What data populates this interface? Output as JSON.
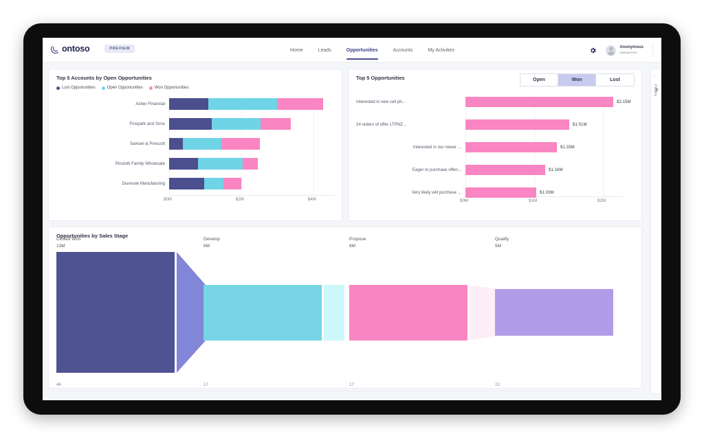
{
  "app": {
    "brand_name": "ontoso",
    "preview_badge": "PREVIEW"
  },
  "nav": {
    "items": [
      {
        "label": "Home",
        "active": false
      },
      {
        "label": "Leads",
        "active": false
      },
      {
        "label": "Opportunities",
        "active": true
      },
      {
        "label": "Accounts",
        "active": false
      },
      {
        "label": "My Activities",
        "active": false
      }
    ]
  },
  "topright": {
    "settings_icon": "gear-icon",
    "user_name": "Anonymous",
    "user_role": "Salesperson"
  },
  "filters_rail": {
    "collapse_icon": "chevron-left-icon",
    "funnel_icon": "filter-funnel-icon",
    "label": "Filters"
  },
  "cards": {
    "accounts": {
      "title": "Top 5 Accounts by Open Opportunities",
      "legend": [
        {
          "label": "Lost Opportunities",
          "color": "#4b4f8e"
        },
        {
          "label": "Open Opportunities",
          "color": "#6fd4e6"
        },
        {
          "label": "Won Opportunities",
          "color": "#f985c2"
        }
      ],
      "axis_ticks": [
        "$0M",
        "$2M",
        "$4M"
      ]
    },
    "opportunities": {
      "title": "Top 5 Opportunities",
      "toggle": [
        {
          "label": "Open",
          "selected": false
        },
        {
          "label": "Won",
          "selected": true
        },
        {
          "label": "Lost",
          "selected": false
        }
      ],
      "axis_ticks": [
        "$0M",
        "$1M",
        "$2M"
      ]
    },
    "sales_stage": {
      "title": "Opportunities by Sales Stage"
    }
  },
  "chart_data": [
    {
      "type": "bar",
      "id": "top-5-accounts",
      "orientation": "horizontal",
      "stacked": true,
      "title": "Top 5 Accounts by Open Opportunities",
      "xlabel": "",
      "ylabel": "",
      "xlim": [
        0,
        4.6
      ],
      "xunit": "$M",
      "tick_values": [
        0,
        2,
        4
      ],
      "tick_labels": [
        "$0M",
        "$2M",
        "$4M"
      ],
      "grid": true,
      "legend_position": "top-left",
      "categories": [
        "Asher Financial",
        "Finspark and Sons",
        "Samuel & Prescott",
        "Pinciotti Family Wholesale",
        "Durevole Manufaturing"
      ],
      "series": [
        {
          "name": "Lost Opportunities",
          "color": "#4b4f8e",
          "values": [
            1.08,
            1.18,
            0.38,
            0.8,
            0.97
          ]
        },
        {
          "name": "Open Opportunities",
          "color": "#6fd4e6",
          "values": [
            1.92,
            1.35,
            1.08,
            1.25,
            0.54
          ]
        },
        {
          "name": "Won Opportunities",
          "color": "#f985c2",
          "values": [
            1.28,
            0.84,
            1.06,
            0.42,
            0.5
          ]
        }
      ],
      "totals": [
        4.28,
        3.37,
        2.52,
        2.47,
        2.01
      ]
    },
    {
      "type": "bar",
      "id": "top-5-opportunities",
      "orientation": "horizontal",
      "stacked": false,
      "title": "Top 5 Opportunities",
      "filter_selected": "Won",
      "xlabel": "",
      "ylabel": "",
      "xlim": [
        0,
        2.3
      ],
      "xunit": "$M",
      "tick_values": [
        0,
        1,
        2
      ],
      "tick_labels": [
        "$0M",
        "$1M",
        "$2M"
      ],
      "grid": true,
      "bar_color": "#f985c2",
      "categories": [
        "Interested in new cell ph...",
        "24 orders of offer LTPNZ...",
        "Interested in our newer ...",
        "Eager to purchase offeri...",
        "Very likely will purchase ..."
      ],
      "values": [
        2.15,
        1.51,
        1.33,
        1.16,
        1.03
      ],
      "data_labels": [
        "$2.15M",
        "$1.51M",
        "$1.33M",
        "$1.16M",
        "$1.03M"
      ]
    },
    {
      "type": "funnel",
      "id": "opportunities-by-sales-stage",
      "title": "Opportunities by Sales Stage",
      "stages": [
        {
          "name": "Closed Won",
          "value_label": "13M",
          "value": 13,
          "count": "46",
          "color": "#4f5392",
          "connector_color": "#8186d8"
        },
        {
          "name": "Develop",
          "value_label": "6M",
          "value": 6,
          "count": "17",
          "color": "#78d5e5",
          "connector_color": "#cdf8fb"
        },
        {
          "name": "Propose",
          "value_label": "6M",
          "value": 6,
          "count": "17",
          "color": "#f985c2",
          "connector_color": "#fdeef7"
        },
        {
          "name": "Qualify",
          "value_label": "5M",
          "value": 5,
          "count": "22",
          "color": "#b09ce8",
          "connector_color": "#ffffff"
        }
      ]
    }
  ]
}
